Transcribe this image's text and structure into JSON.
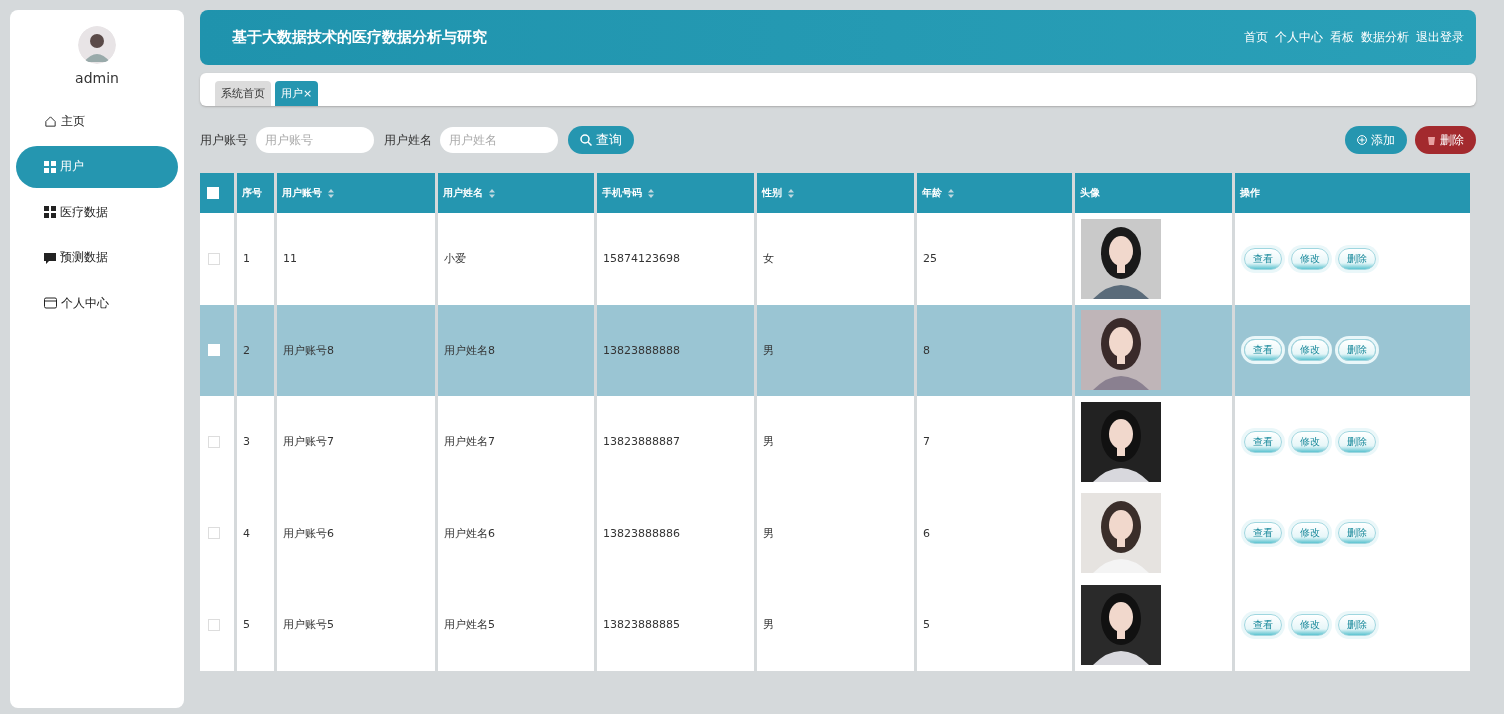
{
  "sidebar": {
    "user_name": "admin",
    "items": [
      {
        "label": "主页",
        "selected": false
      },
      {
        "label": "用户",
        "selected": true
      },
      {
        "label": "医疗数据",
        "selected": false
      },
      {
        "label": "预测数据",
        "selected": false
      },
      {
        "label": "个人中心",
        "selected": false
      }
    ]
  },
  "header": {
    "title": "基于大数据技术的医疗数据分析与研究",
    "links": [
      "首页",
      "个人中心",
      "看板",
      "数据分析",
      "退出登录"
    ]
  },
  "tabs": [
    {
      "label": "系统首页",
      "selected": false
    },
    {
      "label": "用户",
      "selected": true,
      "close_mark": "×"
    }
  ],
  "search": {
    "fields": [
      {
        "label": "用户账号",
        "placeholder": "用户账号"
      },
      {
        "label": "用户姓名",
        "placeholder": "用户姓名"
      }
    ],
    "button": "查询"
  },
  "actions": [
    {
      "label": "添加",
      "kind": "add"
    },
    {
      "label": "删除",
      "kind": "delete"
    }
  ],
  "table": {
    "all_checked": false,
    "columns": [
      {
        "label": "序号",
        "sortable": false
      },
      {
        "label": "用户账号",
        "sortable": true
      },
      {
        "label": "用户姓名",
        "sortable": true
      },
      {
        "label": "手机号码",
        "sortable": true
      },
      {
        "label": "性别",
        "sortable": true
      },
      {
        "label": "年龄",
        "sortable": true
      },
      {
        "label": "头像",
        "sortable": false
      },
      {
        "label": "操作",
        "sortable": false
      }
    ],
    "rows": [
      {
        "index": "1",
        "account": "11",
        "name": "小爱",
        "phone": "15874123698",
        "gender": "女",
        "age": "25",
        "selected": false,
        "checked": false,
        "buttons": [
          "查看",
          "修改",
          "删除"
        ]
      },
      {
        "index": "2",
        "account": "用户账号8",
        "name": "用户姓名8",
        "phone": "13823888888",
        "gender": "男",
        "age": "8",
        "selected": true,
        "checked": false,
        "buttons": [
          "查看",
          "修改",
          "删除"
        ]
      },
      {
        "index": "3",
        "account": "用户账号7",
        "name": "用户姓名7",
        "phone": "13823888887",
        "gender": "男",
        "age": "7",
        "selected": false,
        "checked": false,
        "buttons": [
          "查看",
          "修改",
          "删除"
        ]
      },
      {
        "index": "4",
        "account": "用户账号6",
        "name": "用户姓名6",
        "phone": "13823888886",
        "gender": "男",
        "age": "6",
        "selected": false,
        "checked": false,
        "buttons": [
          "查看",
          "修改",
          "删除"
        ]
      },
      {
        "index": "5",
        "account": "用户账号5",
        "name": "用户姓名5",
        "phone": "13823888885",
        "gender": "男",
        "age": "5",
        "selected": false,
        "checked": false,
        "buttons": [
          "查看",
          "修改",
          "删除"
        ]
      }
    ]
  }
}
